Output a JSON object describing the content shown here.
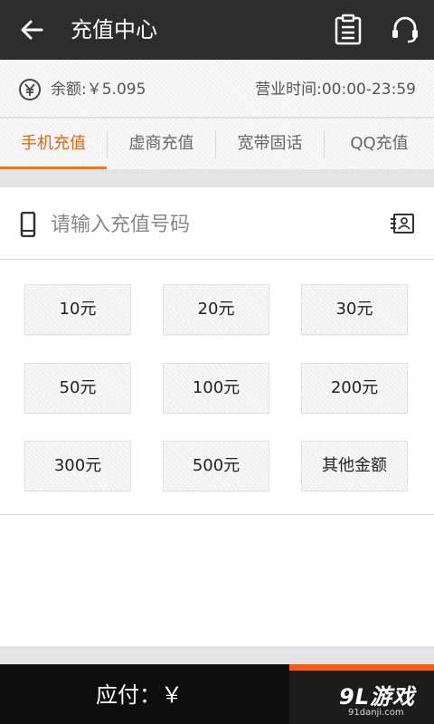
{
  "header": {
    "title": "充值中心",
    "icons": {
      "back": "arrow-left-icon",
      "list": "clipboard-list-icon",
      "service": "headset-icon"
    }
  },
  "info": {
    "balance": "余额:￥5.095",
    "hours": "营业时间:00:00-23:59"
  },
  "tabs": [
    {
      "label": "手机充值",
      "active": true
    },
    {
      "label": "虚商充值",
      "active": false
    },
    {
      "label": "宽带固话",
      "active": false
    },
    {
      "label": "QQ充值",
      "active": false
    }
  ],
  "phone_input": {
    "placeholder": "请输入充值号码",
    "value": ""
  },
  "amounts": [
    "10元",
    "20元",
    "30元",
    "50元",
    "100元",
    "200元",
    "300元",
    "500元",
    "其他金额"
  ],
  "footer": {
    "pay_label": "应付：￥",
    "watermark": "9L游戏",
    "watermark_sub": "91danji.com"
  },
  "colors": {
    "accent": "#e0671a",
    "topbar": "#2d2d2d",
    "footer": "#0e0e0e"
  }
}
